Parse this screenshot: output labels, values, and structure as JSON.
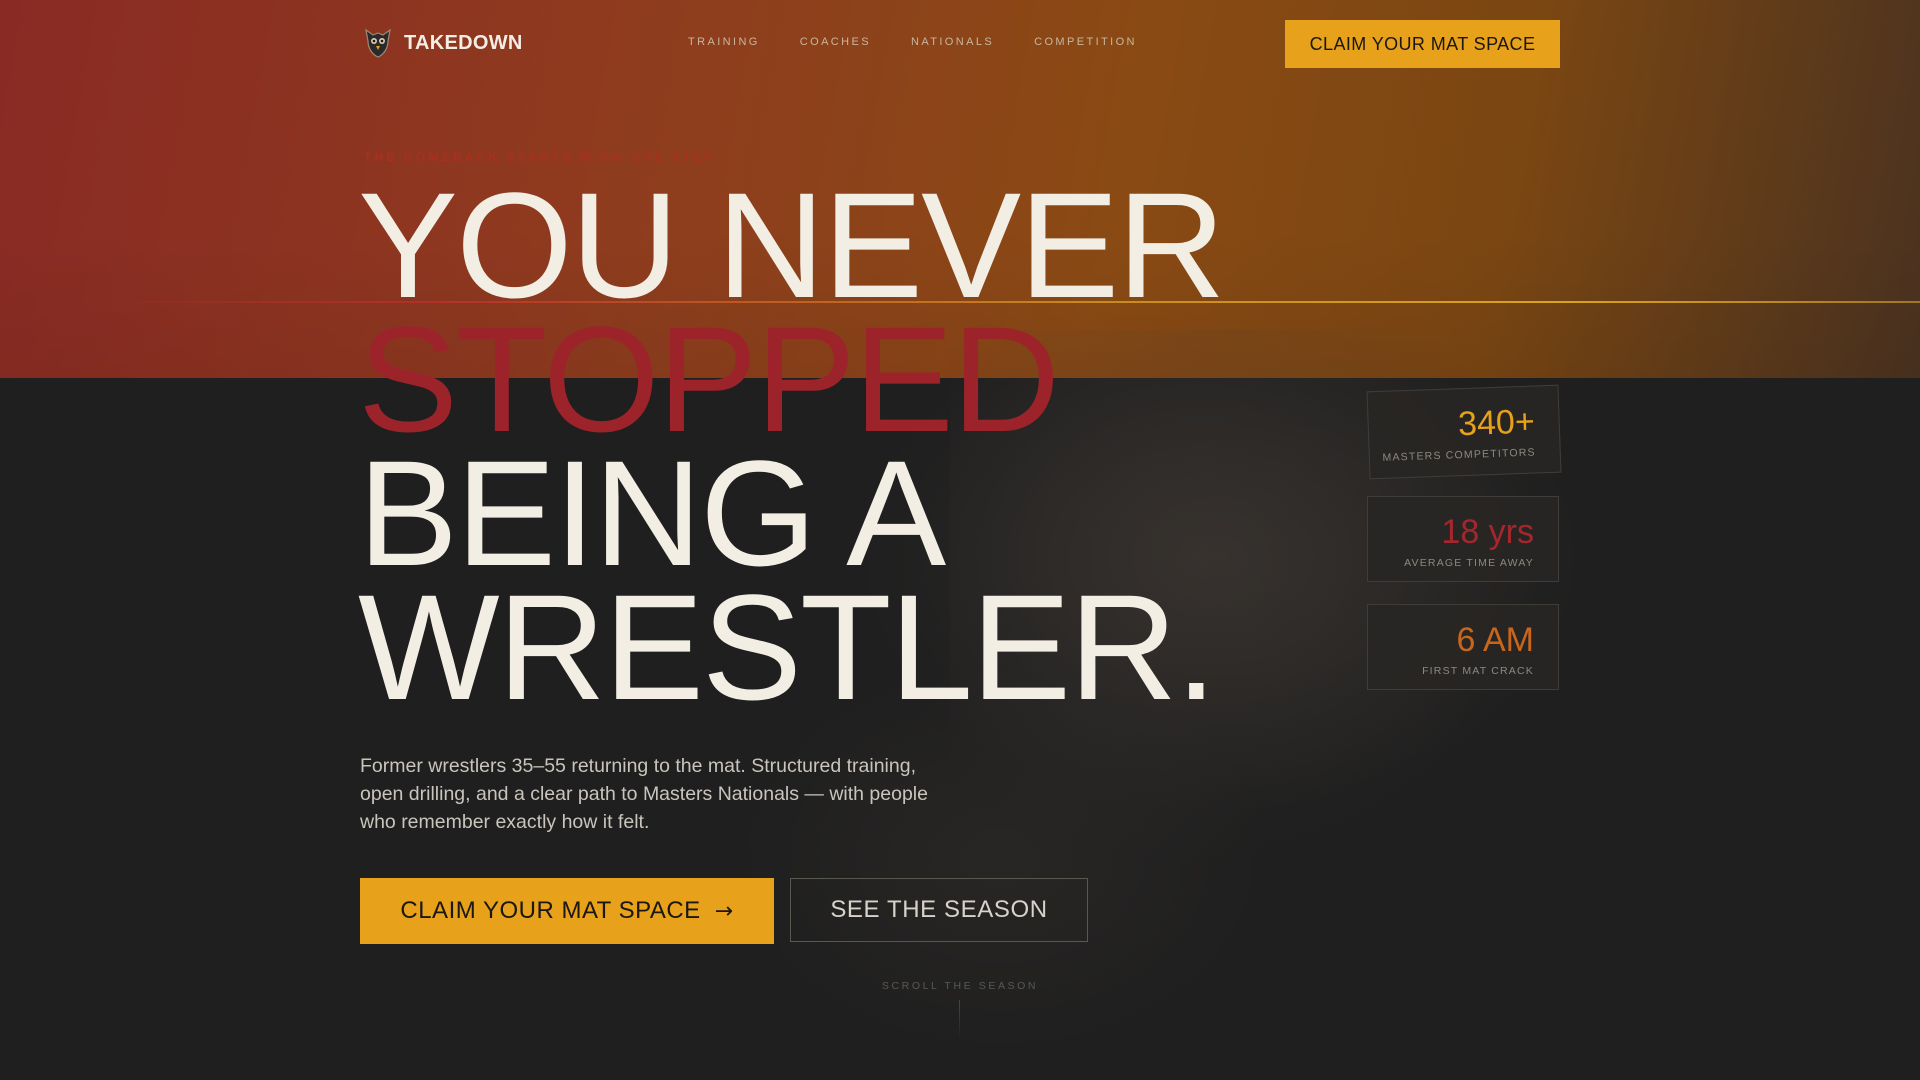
{
  "brand": {
    "name": "TAKEDOWN",
    "logo_icon": "owl-shield-icon"
  },
  "nav": {
    "links": [
      "TRAINING",
      "COACHES",
      "NATIONALS",
      "COMPETITION"
    ],
    "cta_label": "CLAIM YOUR MAT SPACE"
  },
  "hero": {
    "eyebrow": "THE COMEBACK STARTS WITH ONE STEP",
    "headline": {
      "line1": "YOU NEVER",
      "line2": "STOPPED",
      "line3": "BEING A",
      "line4": "WRESTLER."
    },
    "description": "Former wrestlers 35–55 returning to the mat. Structured training, open drilling, and a clear path to Masters Nationals — with people who remember exactly how it felt.",
    "primary_cta": "CLAIM YOUR MAT SPACE",
    "primary_cta_arrow": "→",
    "secondary_cta": "SEE THE SEASON",
    "scroll_hint": "SCROLL THE SEASON"
  },
  "stats": [
    {
      "value": "340+",
      "label": "MASTERS COMPETITORS",
      "color": "#e7a11a"
    },
    {
      "value": "18 yrs",
      "label": "AVERAGE TIME AWAY",
      "color": "#a5262c"
    },
    {
      "value": "6 AM",
      "label": "FIRST MAT CRACK",
      "color": "#c8661c"
    }
  ],
  "colors": {
    "accent_gold": "#e7a11a",
    "accent_red": "#9d232b",
    "cream": "#f3eee4",
    "background": "#1f1f1f"
  }
}
